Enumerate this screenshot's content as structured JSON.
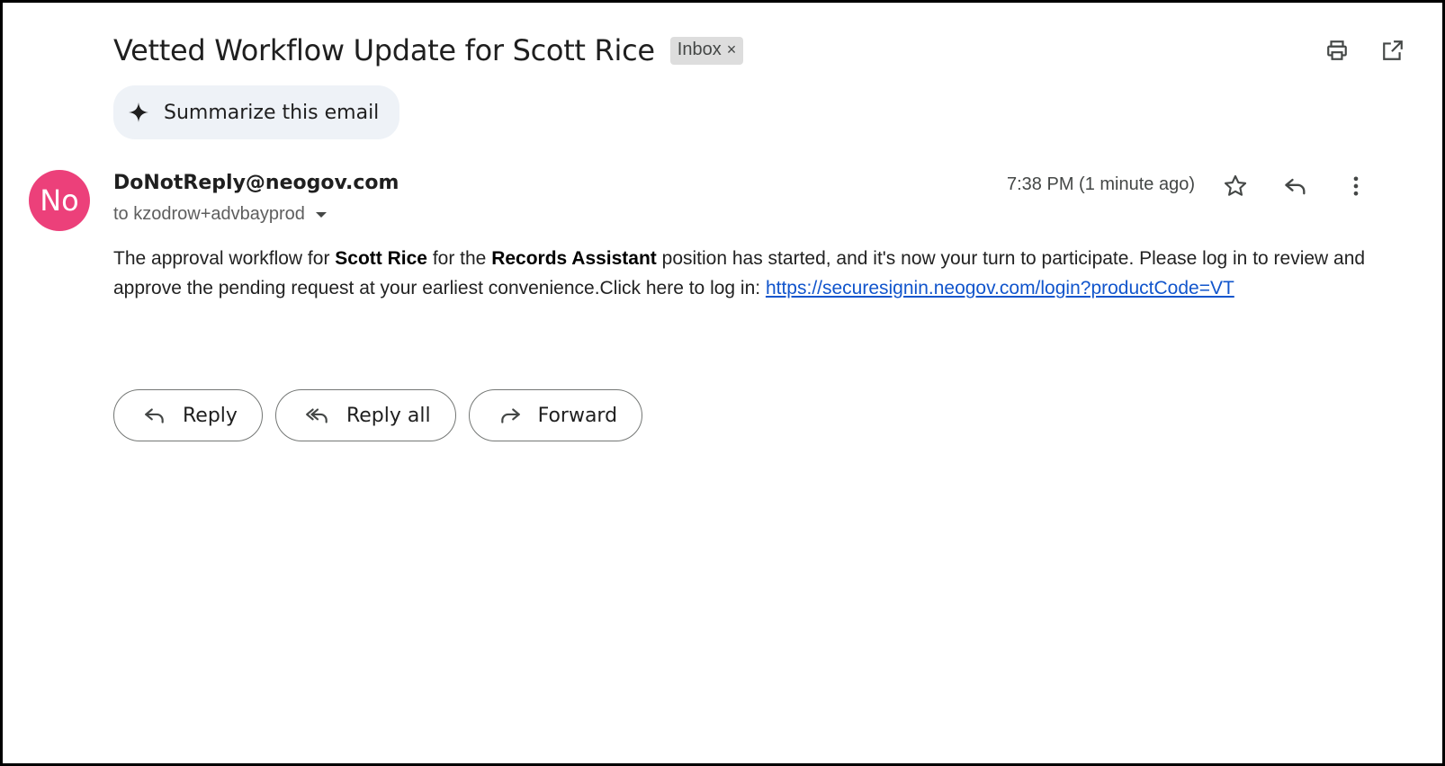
{
  "email": {
    "subject": "Vetted Workflow Update for Scott Rice",
    "label": "Inbox",
    "label_remove": "×",
    "summarize_label": "Summarize this email",
    "sender": {
      "avatar_text": "No",
      "avatar_color": "#ec407a",
      "address": "DoNotReply@neogov.com",
      "recipient": "to kzodrow+advbayprod"
    },
    "time": "7:38 PM (1 minute ago)",
    "body": {
      "p1": "The approval workflow for ",
      "name": "Scott Rice",
      "p2": " for the ",
      "position": "Records Assistant",
      "p3": " position has started, and it's now your turn to participate. Please log in to review and approve the pending request at your earliest convenience.Click here to log in: ",
      "link": "https://securesignin.neogov.com/login?productCode=VT"
    },
    "actions": {
      "reply": "Reply",
      "reply_all": "Reply all",
      "forward": "Forward"
    }
  },
  "icons": {
    "print": "print-icon",
    "open_new_window": "open-in-new-window-icon",
    "sparkle": "sparkle-icon",
    "star": "star-icon",
    "reply": "reply-icon",
    "more": "more-vertical-icon",
    "reply_all": "reply-all-icon",
    "forward": "forward-icon"
  },
  "colors": {
    "link": "#1155cc",
    "summarize_bg": "#eef2f7",
    "chip_bg": "#dddddd"
  }
}
